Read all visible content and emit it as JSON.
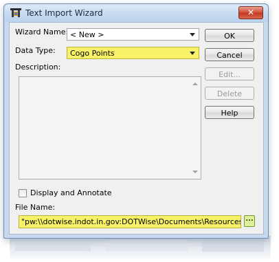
{
  "window": {
    "title": "Text Import Wizard",
    "close_glyph": "✕"
  },
  "fields": {
    "wizard_name_label": "Wizard Name:",
    "wizard_name_value": "< New >",
    "data_type_label": "Data Type:",
    "data_type_value": "Cogo Points",
    "description_label": "Description:",
    "description_value": ""
  },
  "buttons": {
    "ok": "OK",
    "cancel": "Cancel",
    "edit": "Edit...",
    "delete": "Delete",
    "help": "Help",
    "browse": "..."
  },
  "options": {
    "display_annotate_label": "Display and Annotate",
    "display_annotate_checked": false
  },
  "file": {
    "label": "File Name:",
    "value": "\"pw:\\\\dotwise.indot.in.gov:DOTWise\\Documents\\Resources\\Trair"
  },
  "colors": {
    "highlight": "#f8f268",
    "window_frame": "#c6d9ef",
    "close_button": "#c13a22",
    "browse_button": "#dff09a"
  },
  "icons": {
    "app": "app-icon",
    "close": "close-icon",
    "dropdown": "chevron-down-icon",
    "scroll_up": "scroll-up-icon",
    "scroll_down": "scroll-down-icon"
  }
}
